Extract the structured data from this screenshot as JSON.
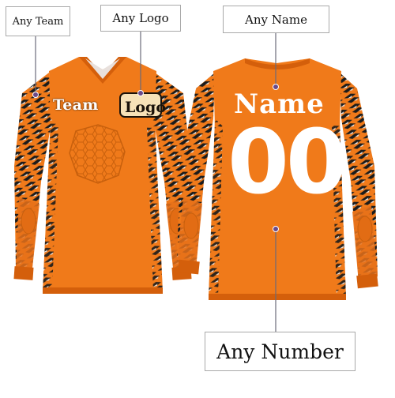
{
  "callouts": {
    "team": "Any Team",
    "logo": "Any Logo",
    "name": "Any Name",
    "number": "Any Number"
  },
  "jersey_front": {
    "team_text": "Team",
    "logo_text": "Logo"
  },
  "jersey_back": {
    "name_text": "Name",
    "number_text": "00"
  },
  "colors": {
    "jersey_orange": "#f07a1a",
    "jersey_dark_orange": "#d45f0b",
    "pattern_black": "#1b1b1b",
    "pattern_white": "#f5f5f5",
    "callout_border": "#a9a9a9",
    "pin": "#6a4a8a"
  }
}
